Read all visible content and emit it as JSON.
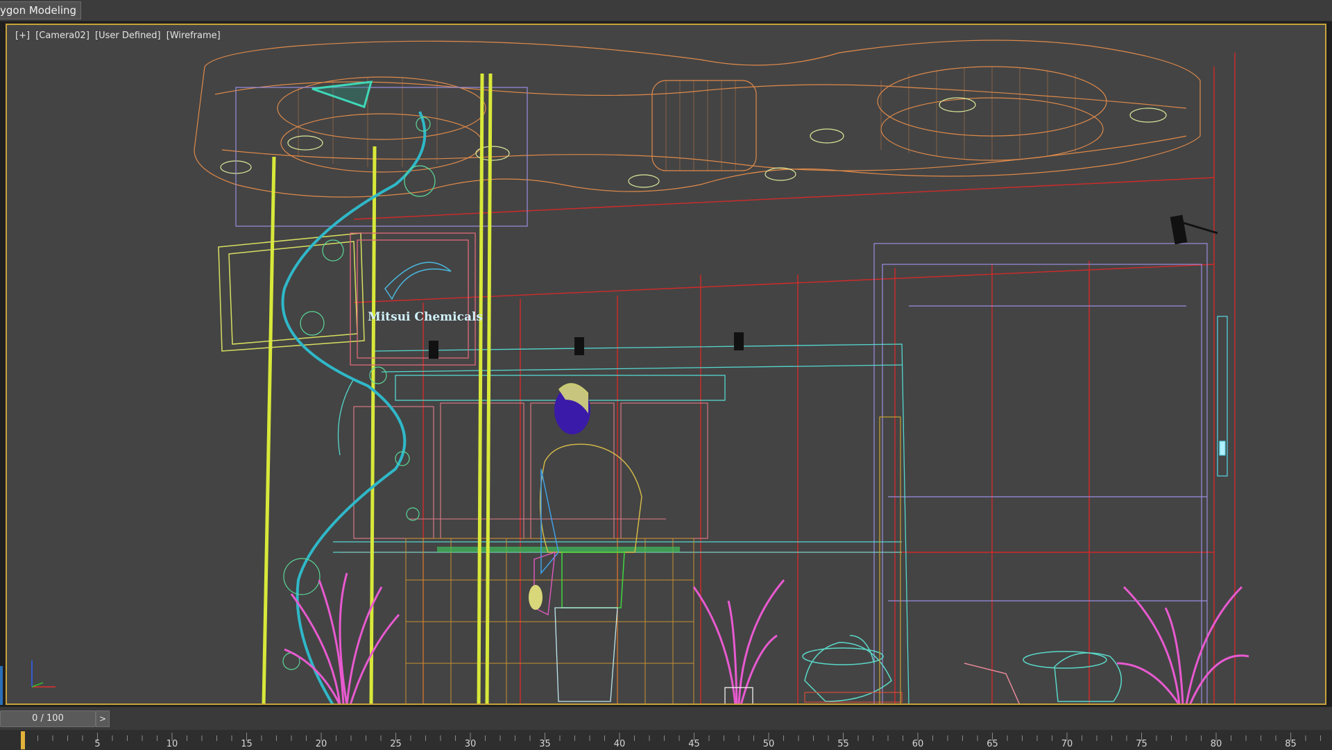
{
  "ribbon": {
    "active_tab": "ygon Modeling"
  },
  "viewport": {
    "labels": [
      "[+]",
      "[Camera02]",
      "[User Defined]",
      "[Wireframe]"
    ],
    "sign_text": "Mitsui Chemicals",
    "border_color": "#c8a23a",
    "background_color": "#444444"
  },
  "timeline": {
    "frame_display": "0 / 100",
    "next_label": ">",
    "ticks": [
      "5",
      "10",
      "15",
      "20",
      "25",
      "30",
      "35",
      "40",
      "45",
      "50",
      "55",
      "60",
      "65",
      "70",
      "75",
      "80",
      "85"
    ],
    "marker_color": "#e2b23a"
  },
  "icons": {
    "axis": "axis-tripod-icon",
    "next": "chevron-right-icon"
  }
}
